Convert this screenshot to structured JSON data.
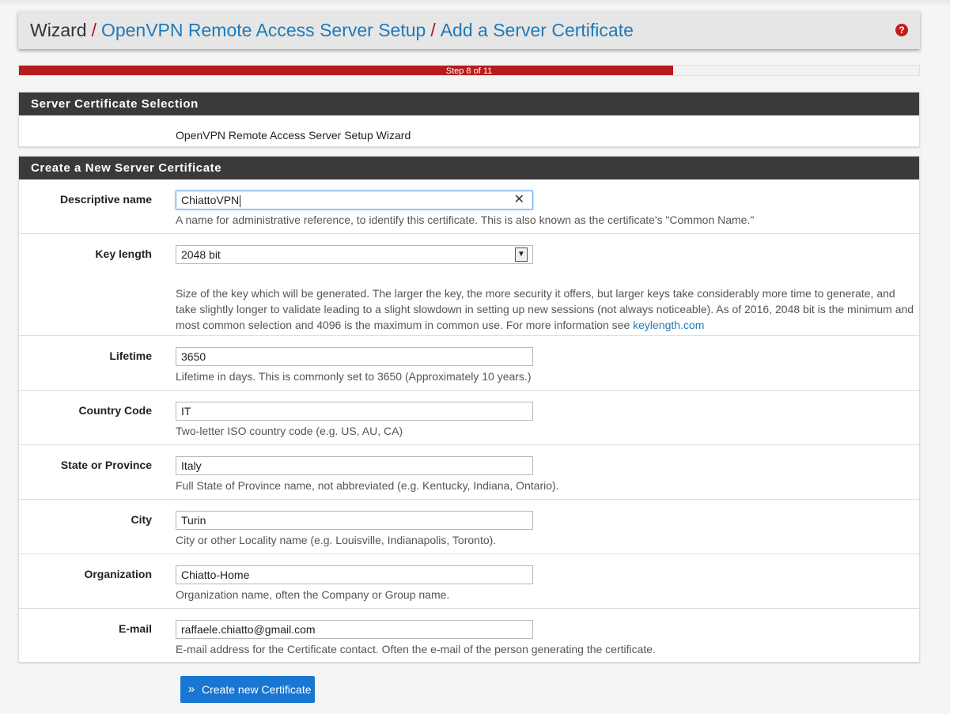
{
  "breadcrumb": {
    "root": "Wizard",
    "separator": "/",
    "items": [
      "OpenVPN Remote Access Server Setup",
      "Add a Server Certificate"
    ]
  },
  "progress": {
    "label": "Step 8 of 11",
    "percent": 72.7
  },
  "selection_panel": {
    "title": "Server Certificate Selection",
    "text": "OpenVPN Remote Access Server Setup Wizard"
  },
  "create_panel": {
    "title": "Create a New Server Certificate",
    "fields": [
      {
        "label": "Descriptive name",
        "value": "ChiattoVPN",
        "help": "A name for administrative reference, to identify this certificate. This is also known as the certificate's \"Common Name.\""
      },
      {
        "label": "Key length",
        "value": "2048 bit",
        "help": "Size of the key which will be generated. The larger the key, the more security it offers, but larger keys take considerably more time to generate, and take slightly longer to validate leading to a slight slowdown in setting up new sessions (not always noticeable). As of 2016, 2048 bit is the minimum and most common selection and 4096 is the maximum in common use. For more information see ",
        "help_link": "keylength.com"
      },
      {
        "label": "Lifetime",
        "value": "3650",
        "help": "Lifetime in days. This is commonly set to 3650 (Approximately 10 years.)"
      },
      {
        "label": "Country Code",
        "value": "IT",
        "help": "Two-letter ISO country code (e.g. US, AU, CA)"
      },
      {
        "label": "State or Province",
        "value": "Italy",
        "help": "Full State of Province name, not abbreviated (e.g. Kentucky, Indiana, Ontario)."
      },
      {
        "label": "City",
        "value": "Turin",
        "help": "City or other Locality name (e.g. Louisville, Indianapolis, Toronto)."
      },
      {
        "label": "Organization",
        "value": "Chiatto-Home",
        "help": "Organization name, often the Company or Group name."
      },
      {
        "label": "E-mail",
        "value": "raffaele.chiatto@gmail.com",
        "help": "E-mail address for the Certificate contact. Often the e-mail of the person generating the certificate."
      }
    ]
  },
  "submit": {
    "label": "Create new Certificate"
  },
  "colors": {
    "accent_red": "#b71c1c",
    "link_blue": "#1f7ab8",
    "button_blue": "#1976d2",
    "panel_heading": "#3a3a3a"
  },
  "icons": {
    "help": "question-circle-icon",
    "clear": "times-icon",
    "submit": "angle-double-right-icon",
    "select": "chevron-down-icon"
  }
}
